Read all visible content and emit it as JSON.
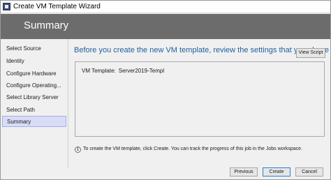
{
  "window": {
    "title": "Create VM Template Wizard"
  },
  "header": {
    "title": "Summary"
  },
  "sidebar": {
    "items": [
      {
        "label": "Select Source"
      },
      {
        "label": "Identity"
      },
      {
        "label": "Configure Hardware"
      },
      {
        "label": "Configure Operating..."
      },
      {
        "label": "Select Library Server"
      },
      {
        "label": "Select Path"
      },
      {
        "label": "Summary",
        "selected": true
      }
    ]
  },
  "main": {
    "heading": "Before you create the new VM template, review the settings that you chose",
    "view_script_label": "View Script",
    "summary": {
      "label": "VM Template:",
      "value": "Server2019-Templ"
    },
    "info_icon": "info-circle-icon",
    "info_text": "To create the VM template, click Create. You can track the progress of this job in the Jobs workspace."
  },
  "footer": {
    "previous_label": "Previous",
    "create_label": "Create",
    "cancel_label": "Cancel"
  },
  "colors": {
    "header_bg": "#6c6c6c",
    "heading_text": "#1f5f9e",
    "selected_item_bg": "#d9dcf7",
    "default_button_border": "#2b7bd8"
  }
}
